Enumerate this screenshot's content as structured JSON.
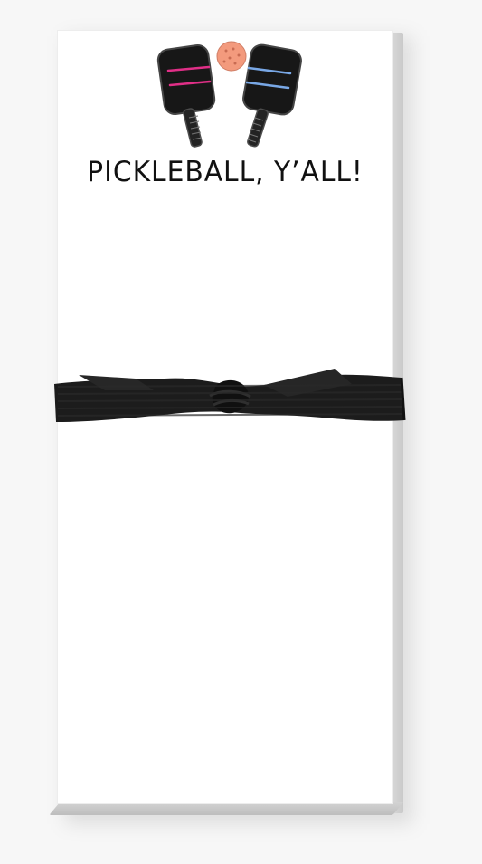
{
  "product": {
    "headline": "PICKLEBALL, Y’ALL!",
    "colors": {
      "paddle_body": "#171717",
      "paddle_left_stripe": "#e02f87",
      "paddle_right_stripe": "#79a8e6",
      "ball": "#f39a7d",
      "ribbon": "#1c1c1c",
      "paper": "#ffffff"
    },
    "icons": [
      "pickleball-paddle-left-icon",
      "pickleball-icon",
      "pickleball-paddle-right-icon"
    ]
  }
}
